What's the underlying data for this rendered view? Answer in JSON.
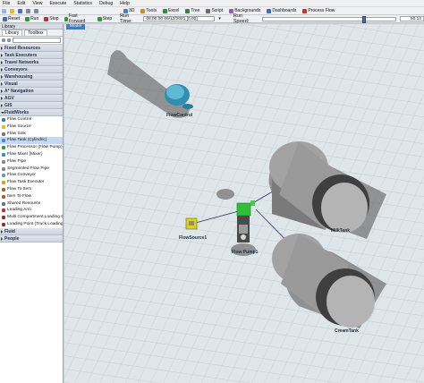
{
  "menu": [
    "File",
    "Edit",
    "View",
    "Execute",
    "Statistics",
    "Debug",
    "Help"
  ],
  "toolbar": [
    {
      "label": "3D",
      "color": "#4a7cc0"
    },
    {
      "label": "Tools",
      "color": "#d08a2c"
    },
    {
      "label": "Excel",
      "color": "#2f8a3c"
    },
    {
      "label": "Tree",
      "color": "#3c7d3c"
    },
    {
      "label": "Script",
      "color": "#6a6a6a"
    },
    {
      "label": "Backgrounds",
      "color": "#8a5fb0"
    },
    {
      "label": "Dashboards",
      "color": "#3a6fb5"
    },
    {
      "label": "Process Flow",
      "color": "#c0392b"
    }
  ],
  "runbar": {
    "reset": "Reset",
    "run": "Run",
    "stop": "Stop",
    "fast_forward": "Fast Forward",
    "step": "Step",
    "run_time_label": "Run Time:",
    "run_time_value": "08:00:00  09/12/2021  [0.00]",
    "run_speed_label": "Run Speed:",
    "run_speed_value": "50.14",
    "speed_fraction": 0.68
  },
  "library": {
    "title": "Library",
    "tabs": [
      "Library",
      "Toolbox"
    ],
    "sections": [
      {
        "label": "Fixed Resources",
        "open": false
      },
      {
        "label": "Task Executers",
        "open": false
      },
      {
        "label": "Travel Networks",
        "open": false
      },
      {
        "label": "Conveyors",
        "open": false
      },
      {
        "label": "Warehousing",
        "open": false
      },
      {
        "label": "Visual",
        "open": false
      },
      {
        "label": "A* Navigation",
        "open": false
      },
      {
        "label": "AGV",
        "open": false
      },
      {
        "label": "GIS",
        "open": false
      },
      {
        "label": "FluidWorks",
        "open": true
      }
    ],
    "fluid_items": [
      {
        "label": "Flow Control",
        "color": "#2f7fb8"
      },
      {
        "label": "Flow Source",
        "color": "#d8c020"
      },
      {
        "label": "Flow Sink",
        "color": "#7a7a7a"
      },
      {
        "label": "Flow Tank (Cylindric)",
        "color": "#3a8fd0",
        "selected": true
      },
      {
        "label": "Flow Processor (Flow Pump)",
        "color": "#27a33a"
      },
      {
        "label": "Flow Mixer (Mixer)",
        "color": "#3a8fd0"
      },
      {
        "label": "Flow Pipe",
        "color": "#888888"
      },
      {
        "label": "Segmented Flow Pipe",
        "color": "#888888"
      },
      {
        "label": "Flow Conveyor",
        "color": "#5aa0c8"
      },
      {
        "label": "Flow Task Executer",
        "color": "#d8a020"
      },
      {
        "label": "Flow To Item",
        "color": "#b85c2c"
      },
      {
        "label": "Item To Flow",
        "color": "#b85c2c"
      },
      {
        "label": "Shared Resource",
        "color": "#6a6aa8"
      },
      {
        "label": "Leading Arm",
        "color": "#c03030"
      },
      {
        "label": "Multi Compartment Loading Control",
        "color": "#a03030"
      },
      {
        "label": "Loading Point (Truck Loading)",
        "color": "#a03030"
      }
    ],
    "bottom_sections": [
      {
        "label": "Fluid",
        "open": false
      },
      {
        "label": "People",
        "open": false
      }
    ]
  },
  "viewport": {
    "tab": "Model",
    "objects": {
      "flow_control": "FlowControl",
      "flow_source": "FlowSource1",
      "flow_pump": "Flow Pump1",
      "milk_tank": "MilkTank",
      "cream_tank": "CreamTank"
    }
  }
}
